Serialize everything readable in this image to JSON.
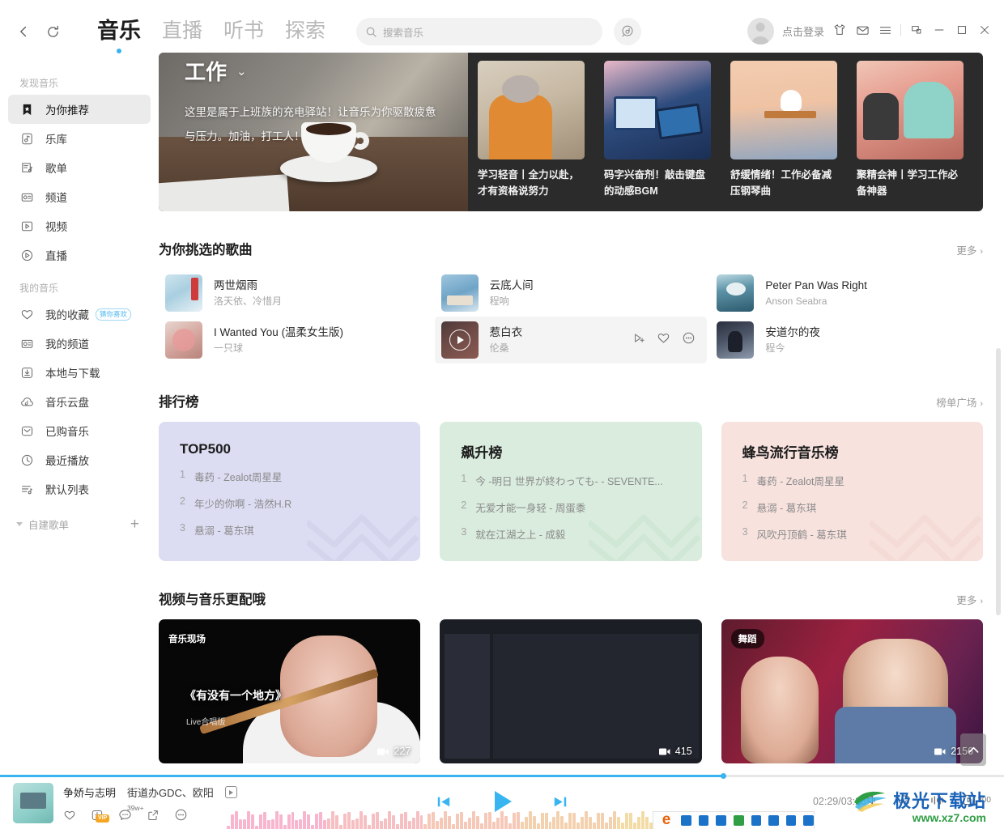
{
  "titlebar": {
    "back_icon": "chevron-left-icon",
    "refresh_icon": "refresh-icon",
    "tabs": [
      {
        "label": "音乐",
        "active": true
      },
      {
        "label": "直播",
        "active": false
      },
      {
        "label": "听书",
        "active": false
      },
      {
        "label": "探索",
        "active": false
      }
    ],
    "search": {
      "placeholder": "搜索音乐",
      "value": ""
    },
    "voice_icon": "voice-search-icon",
    "user": {
      "name": "点击登录"
    },
    "win_icons": [
      "tshirt-icon",
      "mail-icon",
      "menu-icon",
      "mini-window-icon",
      "minimize-icon",
      "maximize-icon",
      "close-icon"
    ]
  },
  "sidebar": {
    "groups": [
      {
        "title": "发现音乐",
        "items": [
          {
            "label": "为你推荐",
            "icon": "bookmark-star-icon",
            "active": true
          },
          {
            "label": "乐库",
            "icon": "music-disc-icon",
            "active": false
          },
          {
            "label": "歌单",
            "icon": "playlist-icon",
            "active": false
          },
          {
            "label": "频道",
            "icon": "radio-icon",
            "active": false
          },
          {
            "label": "视频",
            "icon": "video-icon",
            "active": false
          },
          {
            "label": "直播",
            "icon": "live-play-icon",
            "active": false
          }
        ]
      },
      {
        "title": "我的音乐",
        "items": [
          {
            "label": "我的收藏",
            "icon": "heart-icon",
            "badge": "猜你喜欢",
            "active": false
          },
          {
            "label": "我的频道",
            "icon": "radio-icon",
            "active": false
          },
          {
            "label": "本地与下载",
            "icon": "download-icon",
            "active": false
          },
          {
            "label": "音乐云盘",
            "icon": "cloud-icon",
            "active": false
          },
          {
            "label": "已购音乐",
            "icon": "purchased-icon",
            "active": false
          },
          {
            "label": "最近播放",
            "icon": "clock-icon",
            "active": false
          },
          {
            "label": "默认列表",
            "icon": "list-music-icon",
            "active": false
          }
        ]
      }
    ],
    "footer": {
      "label": "自建歌单",
      "add_icon": "plus-icon",
      "collapse_icon": "triangle-down-icon"
    }
  },
  "banner": {
    "title": "工作",
    "chevron": "⌄",
    "subtitle": "这里是属于上班族的充电驿站！让音乐为你驱散疲惫与压力。加油，打工人！",
    "cards": [
      {
        "caption": "学习轻音丨全力以赴，才有资格说努力",
        "thumb": "student-bookshelf-illustration"
      },
      {
        "caption": "码字兴奋剂！敲击键盘的动感BGM",
        "thumb": "computer-desk-illustration"
      },
      {
        "caption": "舒缓情绪！工作必备减压钢琴曲",
        "thumb": "working-at-desk-illustration"
      },
      {
        "caption": "聚精会神丨学习工作必备神器",
        "thumb": "girl-with-cat-illustration"
      }
    ]
  },
  "songs_section": {
    "title": "为你挑选的歌曲",
    "more": "更多",
    "more_chevron": "›",
    "rows": [
      {
        "title": "两世烟雨",
        "artist": "洛天依、冷惜月",
        "cover": "cv1",
        "hover": false
      },
      {
        "title": "云底人间",
        "artist": "程响",
        "cover": "cv2",
        "hover": false
      },
      {
        "title": "Peter Pan Was Right",
        "artist": "Anson Seabra",
        "cover": "cv3",
        "hover": false
      },
      {
        "title": "I Wanted You (温柔女生版)",
        "artist": "一只球",
        "cover": "cv4",
        "hover": false
      },
      {
        "title": "惹白衣",
        "artist": "伦桑",
        "cover": "cv5",
        "hover": true
      },
      {
        "title": "安道尔的夜",
        "artist": "程今",
        "cover": "cv6",
        "hover": false
      }
    ],
    "hover_actions": [
      "add-to-playlist-icon",
      "heart-icon",
      "more-options-icon"
    ],
    "play_overlay_icon": "play-circle-icon"
  },
  "rank_section": {
    "title": "排行榜",
    "more": "榜单广场",
    "more_chevron": "›",
    "cards": [
      {
        "name": "TOP500",
        "bg": "#dcdcf2",
        "items": [
          {
            "rank": "1",
            "text": "毒药 - Zealot周星星"
          },
          {
            "rank": "2",
            "text": "年少的你啊 - 浩然H.R"
          },
          {
            "rank": "3",
            "text": "悬溺 - 葛东琪"
          }
        ]
      },
      {
        "name": "飙升榜",
        "bg": "#d9ecdd",
        "items": [
          {
            "rank": "1",
            "text": "今 -明日 世界が終わっても- - SEVENTE..."
          },
          {
            "rank": "2",
            "text": "无爱才能一身轻 - 周蛋黍"
          },
          {
            "rank": "3",
            "text": "就在江湖之上 - 成毅"
          }
        ]
      },
      {
        "name": "蜂鸟流行音乐榜",
        "bg": "#f7e2de",
        "items": [
          {
            "rank": "1",
            "text": "毒药 - Zealot周星星"
          },
          {
            "rank": "2",
            "text": "悬溺 - 葛东琪"
          },
          {
            "rank": "3",
            "text": "风吹丹顶鹤 - 葛东琪"
          }
        ]
      }
    ]
  },
  "video_section": {
    "title": "视频与音乐更配哦",
    "more": "更多",
    "more_chevron": "›",
    "cards": [
      {
        "tag": "音乐现场",
        "tag_style": "plain",
        "count": "227",
        "overlay_title": "《有没有一个地方》",
        "overlay_sub": "Live合唱版",
        "thumb": "flute-performance"
      },
      {
        "tag": "",
        "tag_style": "none",
        "count": "415",
        "thumb": "daw-software-screen"
      },
      {
        "tag": "舞蹈",
        "tag_style": "chip",
        "count": "2156",
        "thumb": "girl-group-stage"
      }
    ],
    "count_icon": "video-camera-icon"
  },
  "back_to_top": {
    "icon": "chevron-up-icon"
  },
  "player": {
    "song_title": "争娇与志明",
    "artist": "街道办GDC、欧阳",
    "mv_icon": "mv-icon",
    "actions": [
      {
        "icon": "heart-icon",
        "name": "favorite"
      },
      {
        "icon": "download-vip-icon",
        "name": "download",
        "chip": "VIP"
      },
      {
        "icon": "comment-icon",
        "name": "comment",
        "count": "39w+"
      },
      {
        "icon": "share-icon",
        "name": "share"
      },
      {
        "icon": "more-options-icon",
        "name": "more"
      }
    ],
    "controls": [
      {
        "icon": "previous-icon",
        "name": "previous"
      },
      {
        "icon": "play-icon",
        "name": "play"
      },
      {
        "icon": "next-icon",
        "name": "next"
      }
    ],
    "time": "02:29/03:25",
    "progress_percent": 72,
    "right_icons": [
      {
        "icon": "volume-icon",
        "name": "volume"
      },
      {
        "icon": "lyrics-icon",
        "name": "lyrics"
      },
      {
        "icon": "sound-effect-icon",
        "name": "sound-effect"
      },
      {
        "icon": "playlist-queue-icon",
        "name": "queue",
        "count": "300"
      }
    ]
  },
  "watermark": {
    "brand": "极光下载站",
    "url": "www.xz7.com"
  }
}
